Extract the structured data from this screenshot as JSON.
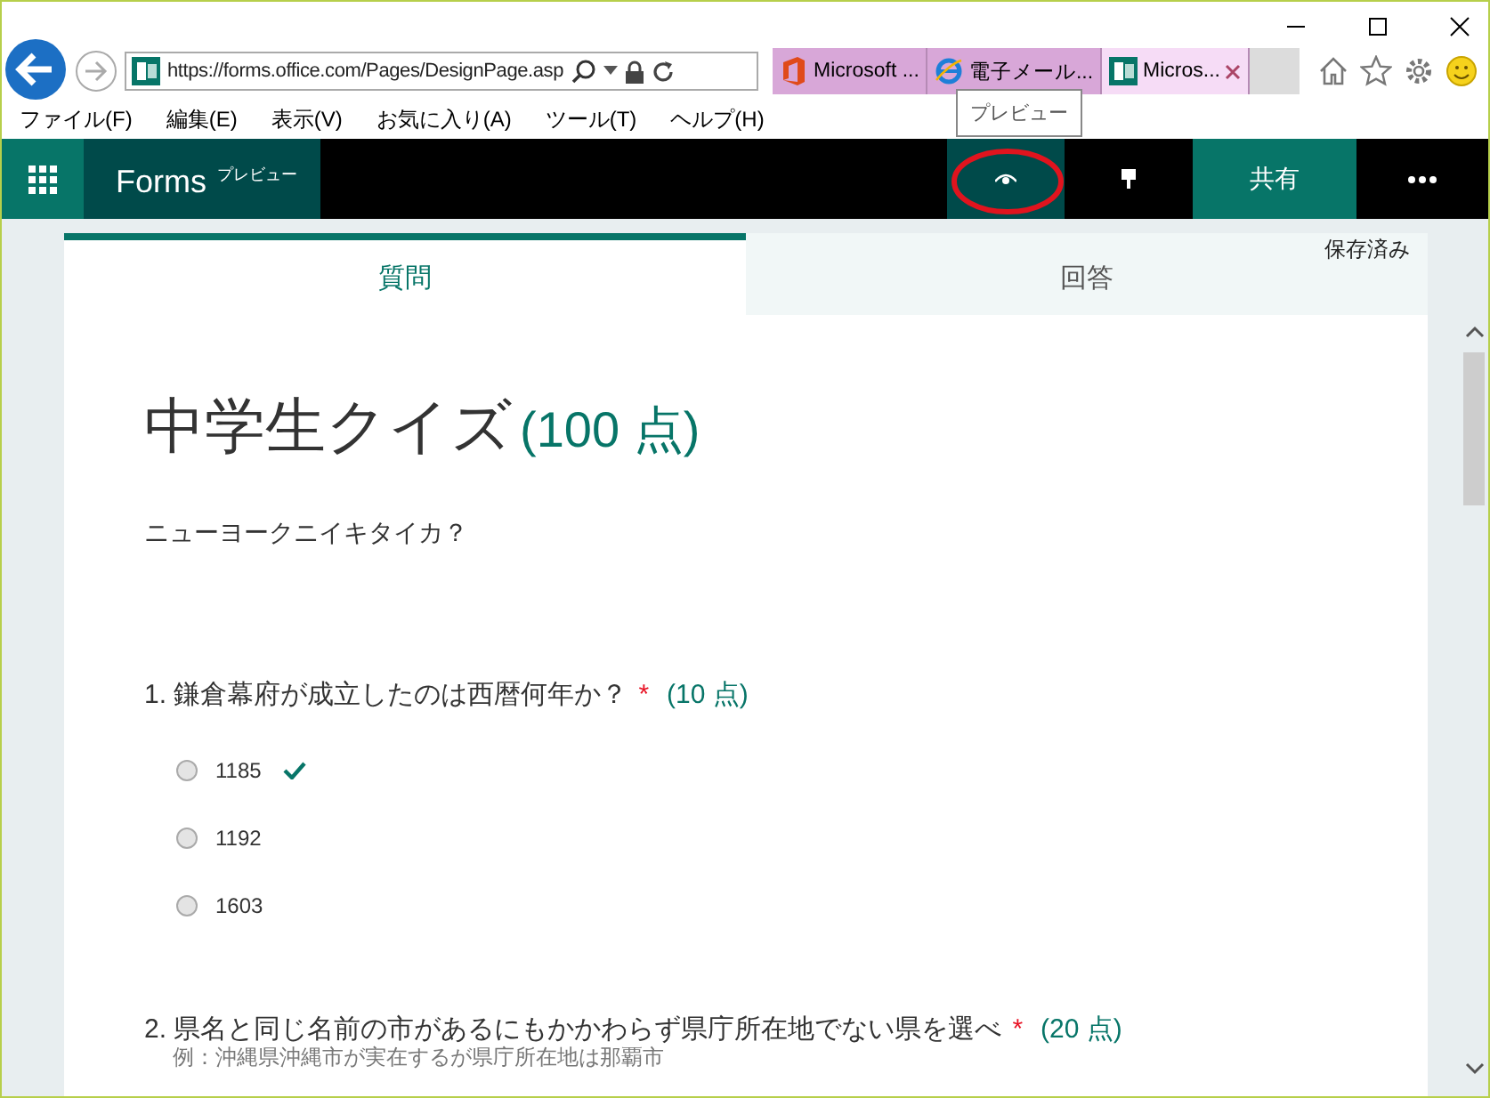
{
  "browser": {
    "address": "https://forms.office.com/Pages/DesignPage.asp",
    "tabs": [
      {
        "label": "Microsoft ...",
        "selected": false
      },
      {
        "label": "電子メール...",
        "selected": false
      },
      {
        "label": "Micros...",
        "selected": true
      }
    ],
    "menu": [
      "ファイル(F)",
      "編集(E)",
      "表示(V)",
      "お気に入り(A)",
      "ツール(T)",
      "ヘルプ(H)"
    ],
    "tooltip": "プレビュー"
  },
  "app_bar": {
    "app_name": "Forms",
    "badge": "プレビュー",
    "share_button": "共有"
  },
  "saved_status": "保存済み",
  "form_tabs": [
    {
      "label": "質問",
      "selected": true
    },
    {
      "label": "回答",
      "selected": false
    }
  ],
  "form": {
    "title": "中学生クイズ",
    "points": "(100 点)",
    "description": "ニューヨークニイキタイカ？",
    "questions": [
      {
        "number": "1.",
        "text": "鎌倉幕府が成立したのは西暦何年か？",
        "required_mark": "*",
        "points": "(10 点)",
        "options": [
          {
            "label": "1185",
            "selected": false,
            "correct": true
          },
          {
            "label": "1192",
            "selected": false,
            "correct": false
          },
          {
            "label": "1603",
            "selected": false,
            "correct": false
          }
        ]
      },
      {
        "number": "2.",
        "text": "県名と同じ名前の市があるにもかかわらず県庁所在地でない県を選べ",
        "required_mark": "*",
        "points": "(20 点)",
        "subtitle": "例：沖縄県沖縄市が実在するが県庁所在地は那覇市"
      }
    ]
  }
}
